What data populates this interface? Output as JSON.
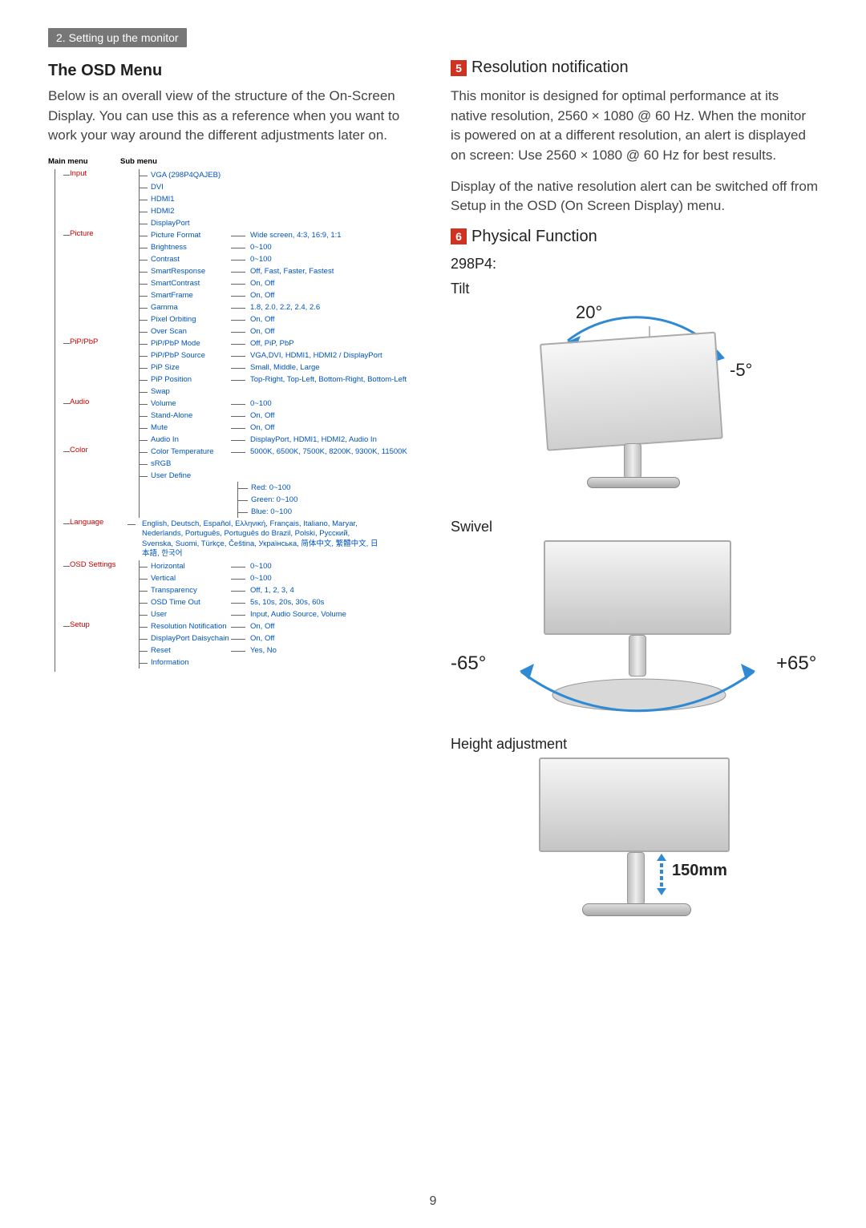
{
  "page_tab": "2. Setting up the monitor",
  "page_number": "9",
  "left": {
    "title": "The OSD Menu",
    "intro": "Below is an overall view of the structure of the On-Screen Display. You can use this as a reference when you want to work your way around the different adjustments later on.",
    "header_main": "Main menu",
    "header_sub": "Sub menu",
    "tree": [
      {
        "name": "Input",
        "subs": [
          {
            "name": "VGA  (298P4QAJEB)"
          },
          {
            "name": "DVI"
          },
          {
            "name": "HDMI1"
          },
          {
            "name": "HDMI2"
          },
          {
            "name": "DisplayPort"
          }
        ]
      },
      {
        "name": "Picture",
        "subs": [
          {
            "name": "Picture Format",
            "vals": "Wide screen, 4:3, 16:9, 1:1"
          },
          {
            "name": "Brightness",
            "vals": "0~100"
          },
          {
            "name": "Contrast",
            "vals": "0~100"
          },
          {
            "name": "SmartResponse",
            "vals": "Off, Fast, Faster, Fastest"
          },
          {
            "name": "SmartContrast",
            "vals": "On, Off"
          },
          {
            "name": "SmartFrame",
            "vals": "On, Off"
          },
          {
            "name": "Gamma",
            "vals": "1.8, 2.0, 2.2, 2.4, 2.6"
          },
          {
            "name": "Pixel Orbiting",
            "vals": "On, Off"
          },
          {
            "name": "Over Scan",
            "vals": "On, Off"
          }
        ]
      },
      {
        "name": "PiP/PbP",
        "subs": [
          {
            "name": "PiP/PbP Mode",
            "vals": "Off, PiP, PbP"
          },
          {
            "name": "PiP/PbP Source",
            "vals": "VGA,DVI, HDMI1, HDMI2 / DisplayPort"
          },
          {
            "name": "PiP Size",
            "vals": "Small, Middle, Large"
          },
          {
            "name": "PiP Position",
            "vals": "Top-Right, Top-Left, Bottom-Right, Bottom-Left"
          },
          {
            "name": "Swap"
          }
        ]
      },
      {
        "name": "Audio",
        "subs": [
          {
            "name": "Volume",
            "vals": "0~100"
          },
          {
            "name": "Stand-Alone",
            "vals": "On, Off"
          },
          {
            "name": "Mute",
            "vals": "On, Off"
          },
          {
            "name": "Audio In",
            "vals": "DisplayPort, HDMI1, HDMI2, Audio In"
          }
        ]
      },
      {
        "name": "Color",
        "subs": [
          {
            "name": "Color Temperature",
            "vals": "5000K, 6500K, 7500K, 8200K, 9300K, 11500K"
          },
          {
            "name": "sRGB"
          },
          {
            "name": "User Define",
            "children": [
              {
                "vals": "Red: 0~100"
              },
              {
                "vals": "Green: 0~100"
              },
              {
                "vals": "Blue: 0~100"
              }
            ]
          }
        ]
      },
      {
        "name": "Language",
        "lang_text": "English, Deutsch, Español, Ελληνική, Français, Italiano, Maryar, Nederlands, Português, Português do Brazil, Polski, Русский, Svenska, Suomi, Türkçe, Čeština, Українська, 简体中文, 繁體中文, 日本語, 한국어"
      },
      {
        "name": "OSD Settings",
        "subs": [
          {
            "name": "Horizontal",
            "vals": "0~100"
          },
          {
            "name": "Vertical",
            "vals": "0~100"
          },
          {
            "name": "Transparency",
            "vals": "Off, 1, 2, 3, 4"
          },
          {
            "name": "OSD Time Out",
            "vals": "5s, 10s, 20s, 30s, 60s"
          },
          {
            "name": "User",
            "vals": "Input, Audio Source, Volume"
          }
        ]
      },
      {
        "name": "Setup",
        "subs": [
          {
            "name": "Resolution Notification",
            "vals": "On, Off"
          },
          {
            "name": "DisplayPort Daisychain",
            "vals": "On, Off"
          },
          {
            "name": "Reset",
            "vals": "Yes, No"
          },
          {
            "name": "Information"
          }
        ]
      }
    ]
  },
  "right": {
    "step5_num": "5",
    "step5_title": "Resolution notification",
    "p1": "This monitor is designed for optimal performance at its native resolution, 2560 × 1080 @ 60 Hz. When the monitor is powered on at a different resolution, an alert is displayed on screen: Use 2560 × 1080 @ 60 Hz for best results.",
    "p2": "Display of the native resolution alert can be switched off from Setup in the OSD (On Screen Display) menu.",
    "step6_num": "6",
    "step6_title": "Physical Function",
    "model": "298P4:",
    "tilt_label": "Tilt",
    "tilt_back": "20°",
    "tilt_fwd": "-5°",
    "swivel_label": "Swivel",
    "swivel_left": "-65°",
    "swivel_right": "+65°",
    "height_label": "Height adjustment",
    "height_value": "150mm"
  }
}
